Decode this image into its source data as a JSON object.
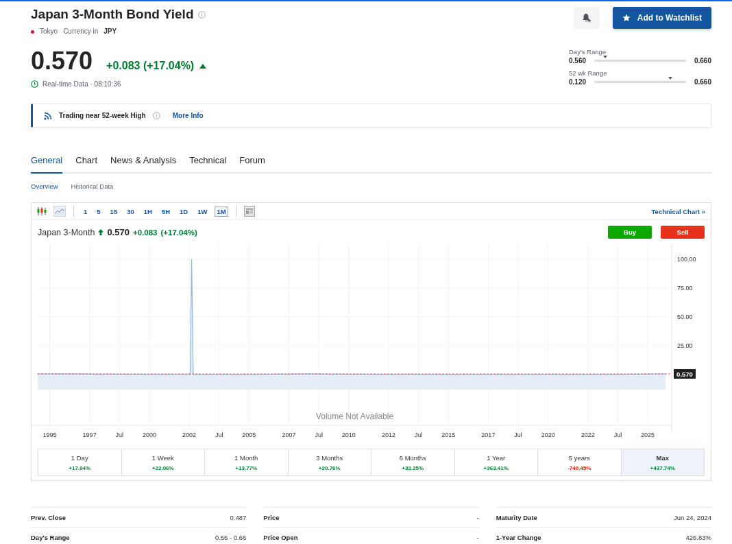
{
  "header": {
    "title": "Japan 3-Month Bond Yield",
    "exchange": "Tokyo",
    "currency_label": "Currency in",
    "currency": "JPY",
    "price": "0.570",
    "change": "+0.083 (+17.04%)",
    "realtime": "Real-time Data · 08:10:36",
    "watchlist_button": "Add to Watchlist"
  },
  "ranges": [
    {
      "label": "Day's Range",
      "low": "0.560",
      "high": "0.660",
      "level": 0.12
    },
    {
      "label": "52 wk Range",
      "low": "0.120",
      "high": "0.660",
      "level": 0.83
    }
  ],
  "alert": {
    "text": "Trading near 52-week High",
    "link": "More Info"
  },
  "tabs": [
    {
      "label": "General",
      "selected": true
    },
    {
      "label": "Chart",
      "selected": false
    },
    {
      "label": "News & Analysis",
      "selected": false
    },
    {
      "label": "Technical",
      "selected": false
    },
    {
      "label": "Forum",
      "selected": false
    }
  ],
  "subtabs": [
    {
      "label": "Overview",
      "selected": true
    },
    {
      "label": "Historical Data",
      "selected": false
    }
  ],
  "chart_toolbar": {
    "chart_types": [
      {
        "kind": "candles",
        "selected": false
      },
      {
        "kind": "line",
        "selected": true
      }
    ],
    "intervals": [
      {
        "label": "1",
        "selected": false
      },
      {
        "label": "5",
        "selected": false
      },
      {
        "label": "15",
        "selected": false
      },
      {
        "label": "30",
        "selected": false
      },
      {
        "label": "1H",
        "selected": false
      },
      {
        "label": "5H",
        "selected": false
      },
      {
        "label": "1D",
        "selected": false
      },
      {
        "label": "1W",
        "selected": false
      },
      {
        "label": "1M",
        "selected": true
      }
    ],
    "link": "Technical Chart »"
  },
  "chart_header": {
    "price": "0.570",
    "change": "+0.083",
    "percent": "(+17.04%)",
    "buy": "Buy",
    "sell": "Sell"
  },
  "chart": {
    "volume_note": "Volume Not Available",
    "chart_data": {
      "type": "area",
      "x": [
        1994.4,
        1996,
        1999,
        2002.05,
        2002.12,
        2002.2,
        2005,
        2008,
        2010,
        2015,
        2020,
        2023,
        2024,
        2025.9
      ],
      "series": [
        {
          "name": "Japan 3-Month",
          "color": "#8fb8dc",
          "values": [
            0.6,
            0.5,
            0.2,
            0.1,
            100,
            0.1,
            0.1,
            0.5,
            0.2,
            0.1,
            0.1,
            0.1,
            0.2,
            0.6
          ]
        }
      ],
      "xlim": [
        1994.4,
        2026.2
      ],
      "ylim": [
        -44,
        113
      ],
      "grid": true,
      "xticks": [
        {
          "value": 1995,
          "label": "1995"
        },
        {
          "value": 1997,
          "label": "1997"
        },
        {
          "value": 1998.5,
          "label": "Jul"
        },
        {
          "value": 2000,
          "label": "2000"
        },
        {
          "value": 2002,
          "label": "2002"
        },
        {
          "value": 2003.5,
          "label": "Jul"
        },
        {
          "value": 2005,
          "label": "2005"
        },
        {
          "value": 2007,
          "label": "2007"
        },
        {
          "value": 2008.5,
          "label": "Jul"
        },
        {
          "value": 2010,
          "label": "2010"
        },
        {
          "value": 2012,
          "label": "2012"
        },
        {
          "value": 2013.5,
          "label": "Jul"
        },
        {
          "value": 2015,
          "label": "2015"
        },
        {
          "value": 2017,
          "label": "2017"
        },
        {
          "value": 2018.5,
          "label": "Jul"
        },
        {
          "value": 2020,
          "label": "2020"
        },
        {
          "value": 2022,
          "label": "2022"
        },
        {
          "value": 2023.5,
          "label": "Jul"
        },
        {
          "value": 2025,
          "label": "2025"
        }
      ],
      "yticks": [
        {
          "value": 25,
          "label": "25.00"
        },
        {
          "value": 50,
          "label": "50.00"
        },
        {
          "value": 75,
          "label": "75.00"
        },
        {
          "value": 100,
          "label": "100.00"
        }
      ],
      "ref_lines": [
        {
          "axis": "y",
          "value": 0.57,
          "label": "0.570"
        }
      ],
      "bands": [
        {
          "axis": "y",
          "from": -13,
          "to": 0
        }
      ]
    }
  },
  "periods": [
    {
      "label": "1 Day",
      "change": "+17.04%",
      "color": "#007c32",
      "selected": false
    },
    {
      "label": "1 Week",
      "change": "+22.06%",
      "color": "#007c32",
      "selected": false
    },
    {
      "label": "1 Month",
      "change": "+13.77%",
      "color": "#007c32",
      "selected": false
    },
    {
      "label": "3 Months",
      "change": "+20.76%",
      "color": "#007c32",
      "selected": false
    },
    {
      "label": "6 Months",
      "change": "+32.25%",
      "color": "#007c32",
      "selected": false
    },
    {
      "label": "1 Year",
      "change": "+363.41%",
      "color": "#007c32",
      "selected": false
    },
    {
      "label": "5 years",
      "change": "-740.45%",
      "color": "#d91400",
      "selected": false
    },
    {
      "label": "Max",
      "change": "+437.74%",
      "color": "#007c32",
      "selected": true
    }
  ],
  "stats": [
    [
      {
        "label": "Prev. Close",
        "value": "0.487"
      },
      {
        "label": "Day's Range",
        "value": "0.56 - 0.66"
      }
    ],
    [
      {
        "label": "Price",
        "value": "-"
      },
      {
        "label": "Price Open",
        "value": "-"
      }
    ],
    [
      {
        "label": "Maturity Date",
        "value": "Jun 24, 2024"
      },
      {
        "label": "1-Year Change",
        "value": "426.83%"
      }
    ]
  ]
}
